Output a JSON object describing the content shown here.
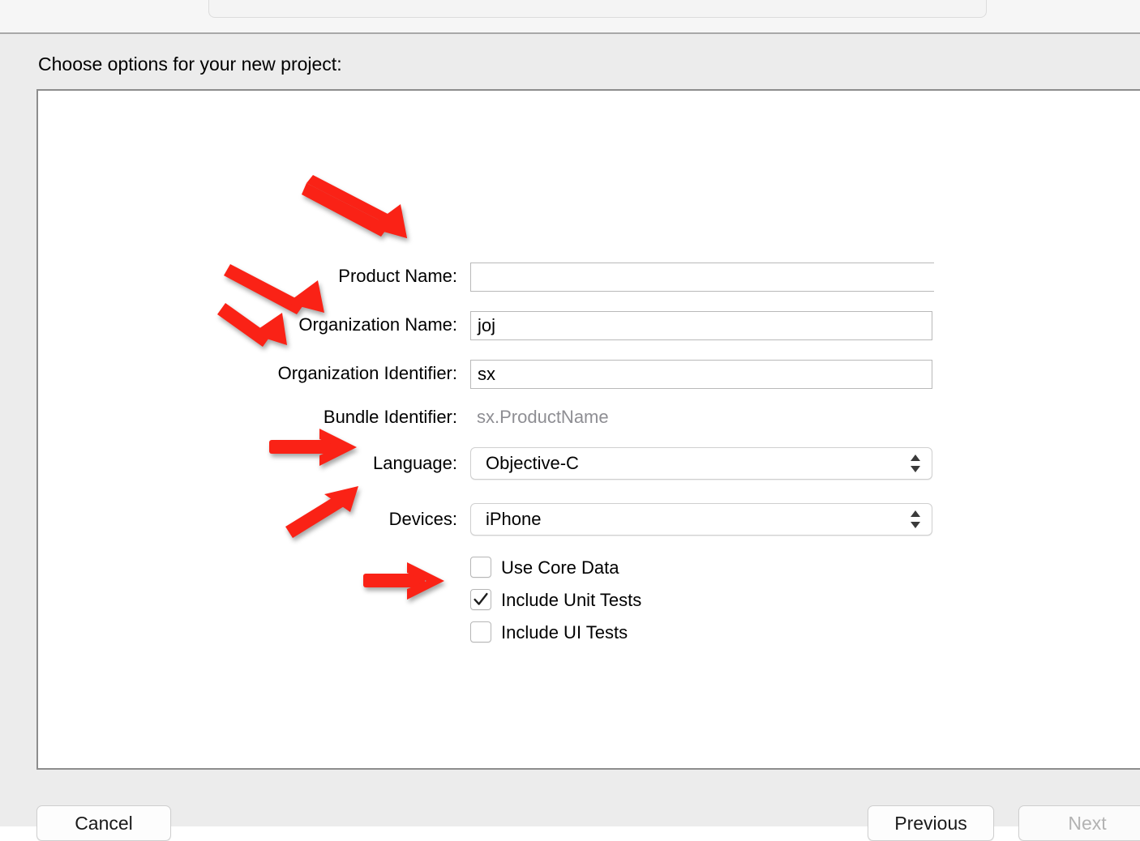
{
  "dialog": {
    "heading": "Choose options for your new project:"
  },
  "form": {
    "rows": [
      {
        "label": "Product Name:",
        "value": "",
        "type": "text"
      },
      {
        "label": "Organization Name:",
        "value": "joj",
        "type": "text"
      },
      {
        "label": "Organization Identifier:",
        "value": "sx",
        "type": "text"
      },
      {
        "label": "Bundle Identifier:",
        "value": "sx.ProductName",
        "type": "static"
      },
      {
        "label": "Language:",
        "value": "Objective-C",
        "type": "popup"
      },
      {
        "label": "Devices:",
        "value": "iPhone",
        "type": "popup"
      }
    ],
    "checkboxes": [
      {
        "label": "Use Core Data",
        "checked": false
      },
      {
        "label": "Include Unit Tests",
        "checked": true
      },
      {
        "label": "Include UI Tests",
        "checked": false
      }
    ]
  },
  "buttons": {
    "cancel": "Cancel",
    "previous": "Previous",
    "next": "Next"
  },
  "icons": {
    "popup_stepper": "chevron-up-down-icon",
    "checkmark": "checkmark-icon",
    "annotation": "red-arrow-icon"
  },
  "colors": {
    "annotation_red": "#FA2216",
    "panel_border": "#8D8D8D",
    "dialog_background": "#ECECEC",
    "static_text": "#8E8E93",
    "disabled_text": "#B3B3B3"
  },
  "annotations": [
    {
      "target": "Product Name:",
      "direction": "down-right"
    },
    {
      "target": "Organization Name:",
      "direction": "down-right"
    },
    {
      "target": "Organization Identifier:",
      "direction": "down-right"
    },
    {
      "target": "Language:",
      "direction": "right"
    },
    {
      "target": "Devices:",
      "direction": "up-right"
    },
    {
      "target": "Include Unit Tests",
      "direction": "right"
    }
  ]
}
